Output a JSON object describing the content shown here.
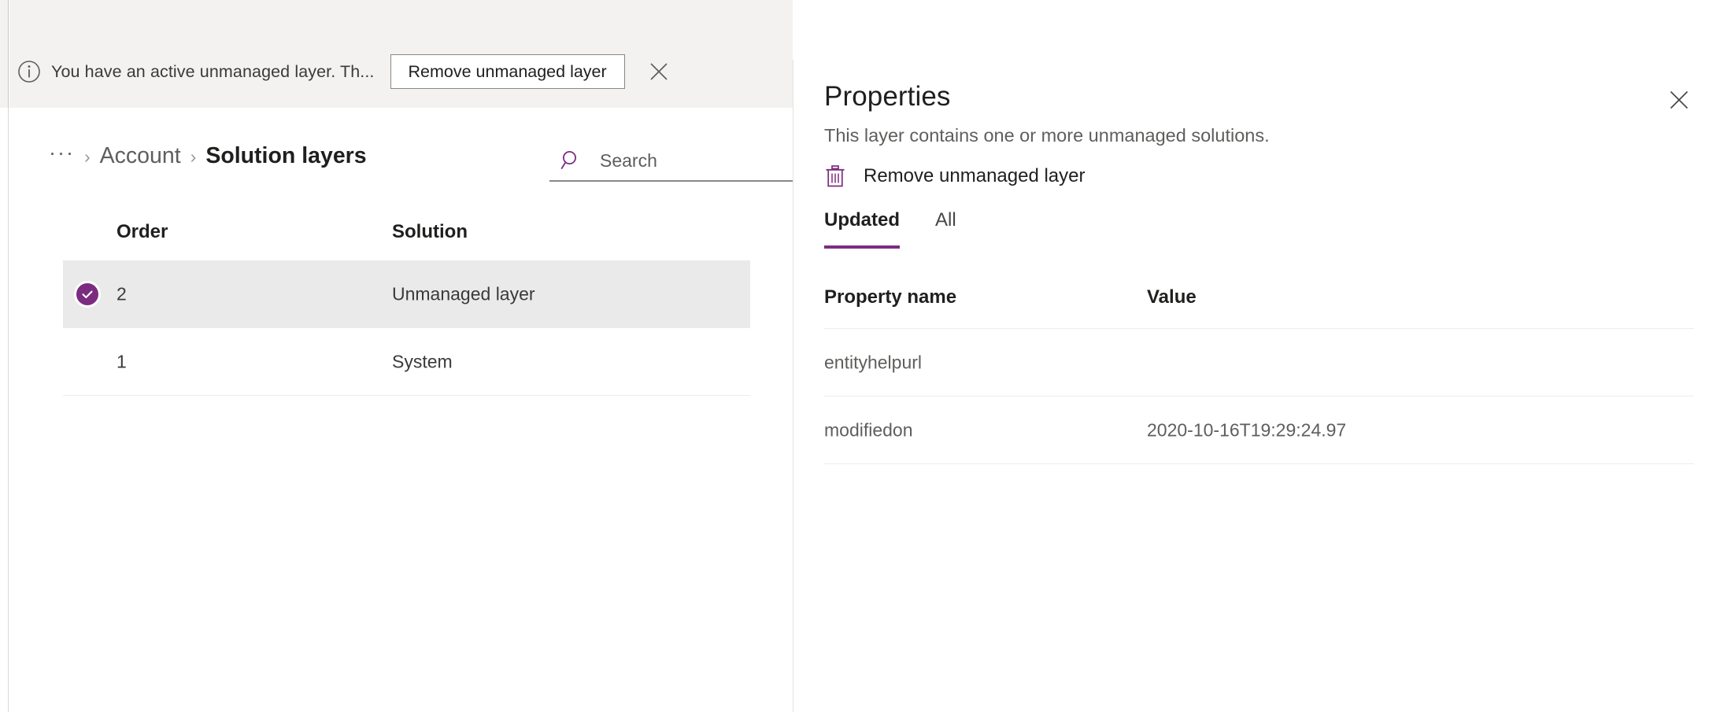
{
  "message_bar": {
    "info_icon": "info-circle-icon",
    "text": "You have an active unmanaged layer. Th...",
    "action_label": "Remove unmanaged layer",
    "close_icon": "close-icon"
  },
  "breadcrumb": {
    "overflow": "···",
    "separator": "›",
    "parent": "Account",
    "current": "Solution layers"
  },
  "search": {
    "icon": "search-icon",
    "placeholder": "Search",
    "value": ""
  },
  "layers_table": {
    "columns": {
      "order": "Order",
      "solution": "Solution"
    },
    "rows": [
      {
        "order": "2",
        "solution": "Unmanaged layer",
        "selected": true
      },
      {
        "order": "1",
        "solution": "System",
        "selected": false
      }
    ]
  },
  "panel": {
    "title": "Properties",
    "subtitle": "This layer contains one or more unmanaged solutions.",
    "close_icon": "close-icon",
    "action": {
      "icon": "trash-icon",
      "label": "Remove unmanaged layer"
    },
    "tabs": [
      {
        "label": "Updated",
        "active": true
      },
      {
        "label": "All",
        "active": false
      }
    ],
    "property_table": {
      "columns": {
        "name": "Property name",
        "value": "Value"
      },
      "rows": [
        {
          "name": "entityhelpurl",
          "value": ""
        },
        {
          "name": "modifiedon",
          "value": "2020-10-16T19:29:24.97"
        }
      ]
    }
  },
  "colors": {
    "accent_purple": "#7c2c80",
    "messagebar_bg": "#f3f2f1",
    "selected_row_bg": "#ebeaea",
    "text_primary": "#201f1e",
    "text_secondary": "#605e5c"
  }
}
